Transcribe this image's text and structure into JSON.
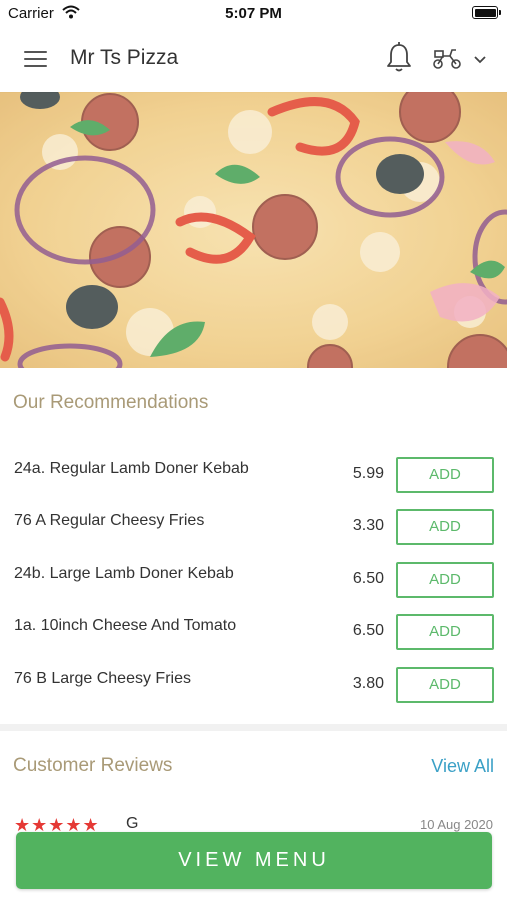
{
  "status_bar": {
    "carrier": "Carrier",
    "time": "5:07 PM"
  },
  "header": {
    "title": "Mr Ts Pizza",
    "icons": [
      "menu-icon",
      "bell-icon",
      "delivery-scooter-icon",
      "chevron-down-icon"
    ]
  },
  "recommendations": {
    "title": "Our Recommendations",
    "add_label": "ADD",
    "items": [
      {
        "name": "24a. Regular Lamb Doner Kebab",
        "price": "5.99"
      },
      {
        "name": "76 A Regular Cheesy Fries",
        "price": "3.30"
      },
      {
        "name": "24b. Large Lamb Doner Kebab",
        "price": "6.50"
      },
      {
        "name": "1a. 10inch Cheese And Tomato",
        "price": "6.50"
      },
      {
        "name": "76 B Large Cheesy Fries",
        "price": "3.80"
      }
    ]
  },
  "reviews": {
    "title": "Customer Reviews",
    "view_all": "View All",
    "first_review": {
      "stars": "★★★★★",
      "rating": 5,
      "reviewer": "G",
      "date": "10 Aug 2020"
    }
  },
  "footer": {
    "view_menu": "VIEW MENU"
  },
  "colors": {
    "accent_green": "#52b35f",
    "title_gold": "#a99a77",
    "link_blue": "#3aa0c6",
    "star_red": "#e53935"
  }
}
